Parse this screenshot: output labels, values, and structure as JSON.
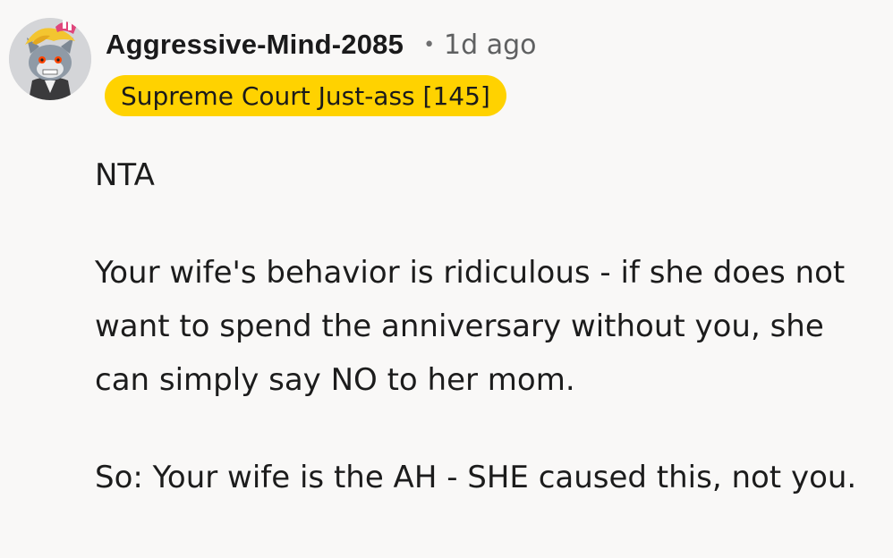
{
  "comment": {
    "author": "Aggressive-Mind-2085",
    "separator": "•",
    "timestamp": "1d ago",
    "flair": "Supreme Court Just-ass [145]",
    "paragraphs": [
      "NTA",
      "Your wife's behavior is ridiculous - if she does not want to spend the anniversary without you, she can simply say NO to her mom.",
      "So: Your wife is the AH - SHE caused this, not you."
    ]
  },
  "colors": {
    "background": "#f9f8f7",
    "flair_background": "#ffd200",
    "text": "#1c1c1c",
    "meta_text": "#5f6061"
  },
  "icons": {
    "avatar": "snoo-avatar-icon"
  }
}
